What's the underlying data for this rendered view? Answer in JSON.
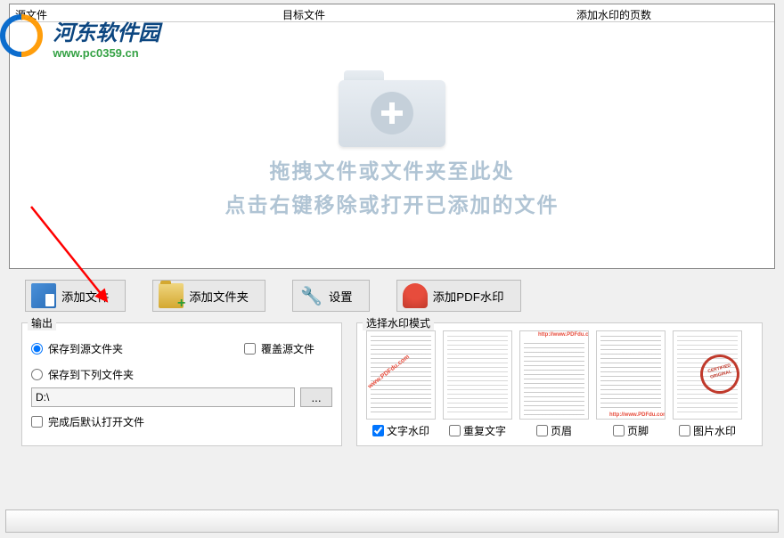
{
  "watermark": {
    "site_name": "河东软件园",
    "site_url": "www.pc0359.cn"
  },
  "table_headers": {
    "source": "源文件",
    "target": "目标文件",
    "pages": "添加水印的页数"
  },
  "drop_zone": {
    "line1": "拖拽文件或文件夹至此处",
    "line2": "点击右键移除或打开已添加的文件"
  },
  "toolbar": {
    "add_file": "添加文件",
    "add_folder": "添加文件夹",
    "settings": "设置",
    "add_watermark": "添加PDF水印"
  },
  "output": {
    "title": "输出",
    "save_source": "保存到源文件夹",
    "overwrite": "覆盖源文件",
    "save_custom": "保存到下列文件夹",
    "path_value": "D:\\",
    "browse_label": "...",
    "open_after": "完成后默认打开文件"
  },
  "watermark_mode": {
    "title": "选择水印模式",
    "modes": [
      {
        "label": "文字水印",
        "checked": true,
        "sample": "www.PDFdu.com"
      },
      {
        "label": "重复文字",
        "checked": false,
        "sample": ""
      },
      {
        "label": "页眉",
        "checked": false,
        "sample": "http://www.PDFdu.com"
      },
      {
        "label": "页脚",
        "checked": false,
        "sample": "http://www.PDFdu.com"
      },
      {
        "label": "图片水印",
        "checked": false,
        "sample": ""
      }
    ]
  }
}
